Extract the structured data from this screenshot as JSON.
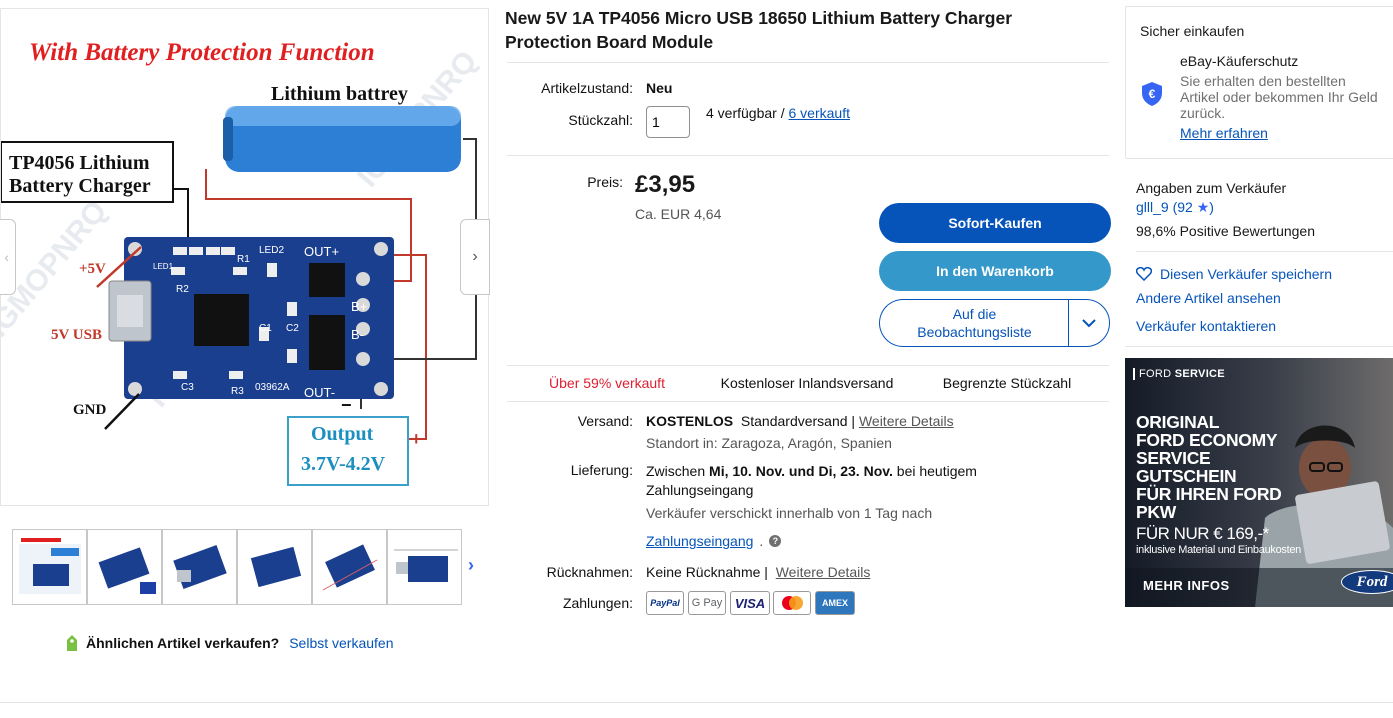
{
  "product": {
    "title_line1": "New 5V 1A TP4056 Micro USB 18650 Lithium Battery Charger",
    "title_line2": "Protection Board Module",
    "image_texts": {
      "headline": "With Battery Protection Function",
      "battery": "Lithium battrey",
      "chip_line1": "TP4056 Lithium",
      "chip_line2": "Battery Charger",
      "plus5v": "+5V",
      "usb": "5V USB",
      "gnd": "GND",
      "output_line1": "Output",
      "output_line2": "3.7V-4.2V",
      "pcb_led1": "LED1",
      "pcb_led2": "LED2",
      "pcb_outp": "OUT+",
      "pcb_outm": "OUT-",
      "pcb_bp": "B+",
      "pcb_bm": "B-",
      "pcb_r1": "R1",
      "pcb_r2": "R2",
      "pcb_r3": "R3",
      "pcb_c1": "C1",
      "pcb_c2": "C2",
      "pcb_c3": "C3",
      "pcb_code": "03962A",
      "watermark": "IGMOPNRQ"
    }
  },
  "details": {
    "condition_label": "Artikelzustand:",
    "condition_value": "Neu",
    "qty_label": "Stückzahl:",
    "qty_value": "1",
    "available": "4 verfügbar /",
    "sold_link": "6 verkauft",
    "price_label": "Preis:",
    "price": "£3,95",
    "price_eur": "Ca. EUR 4,64"
  },
  "buttons": {
    "buy_now": "Sofort-Kaufen",
    "add_to_cart": "In den Warenkorb",
    "watch_line1": "Auf die",
    "watch_line2": "Beobachtungsliste"
  },
  "badges": [
    "Über 59% verkauft",
    "Kostenloser Inlandsversand",
    "Begrenzte Stückzahl"
  ],
  "shipping": {
    "label": "Versand:",
    "free": "KOSTENLOS",
    "standard": "Standardversand |",
    "details_link": "Weitere Details",
    "location": "Standort in: Zaragoza, Aragón, Spanien"
  },
  "delivery": {
    "label": "Lieferung:",
    "text_pre": "Zwischen",
    "date_from": "Mi, 10. Nov.",
    "und": "und",
    "date_to": "Di, 23. Nov.",
    "text_post": "bei heutigem",
    "line2": "Zahlungseingang",
    "seller_ships": "Verkäufer verschickt innerhalb von 1 Tag nach",
    "payment_link": "Zahlungseingang",
    "dot": ".",
    "help_icon_glyph": "?"
  },
  "returns": {
    "label": "Rücknahmen:",
    "value": "Keine Rücknahme |",
    "details_link": "Weitere Details"
  },
  "payments": {
    "label": "Zahlungen:",
    "methods": [
      "PayPal",
      "G Pay",
      "VISA",
      "Mastercard",
      "AMEX"
    ]
  },
  "gallery": {
    "next_glyph": "›",
    "prev_glyph": "‹",
    "thumb_next_glyph": "›",
    "thumb_prev_glyph": "‹"
  },
  "sell": {
    "question": "Ähnlichen Artikel verkaufen?",
    "link": "Selbst verkaufen"
  },
  "buyer_protection": {
    "title": "Sicher einkaufen",
    "name": "eBay-Käuferschutz",
    "desc_line1": "Sie erhalten den bestellten",
    "desc_line2": "Artikel oder bekommen Ihr Geld",
    "desc_line3": "zurück.",
    "more_link": "Mehr erfahren"
  },
  "seller": {
    "title": "Angaben zum Verkäufer",
    "name": "glll_9",
    "rating_open": "(92",
    "rating_close": ")",
    "star": "★",
    "positive": "98,6% Positive Bewertungen",
    "save": "Diesen Verkäufer speichern",
    "other_items": "Andere Artikel ansehen",
    "contact": "Verkäufer kontaktieren"
  },
  "ad": {
    "brand_prefix": "FORD",
    "brand": "SERVICE",
    "lines": [
      "ORIGINAL",
      "FORD ECONOMY",
      "SERVICE",
      "GUTSCHEIN",
      "FÜR IHREN FORD",
      "PKW"
    ],
    "price": "FÜR NUR € 169,-*",
    "note": "inklusive Material und Einbaukosten",
    "cta": "MEHR INFOS",
    "logo": "Ford"
  },
  "colors": {
    "primary_blue": "#0654ba",
    "cart_blue": "#3498ca",
    "red": "#dd1e31",
    "pcb_blue": "#1b3f8f",
    "battery_blue": "#2d7fd6"
  }
}
